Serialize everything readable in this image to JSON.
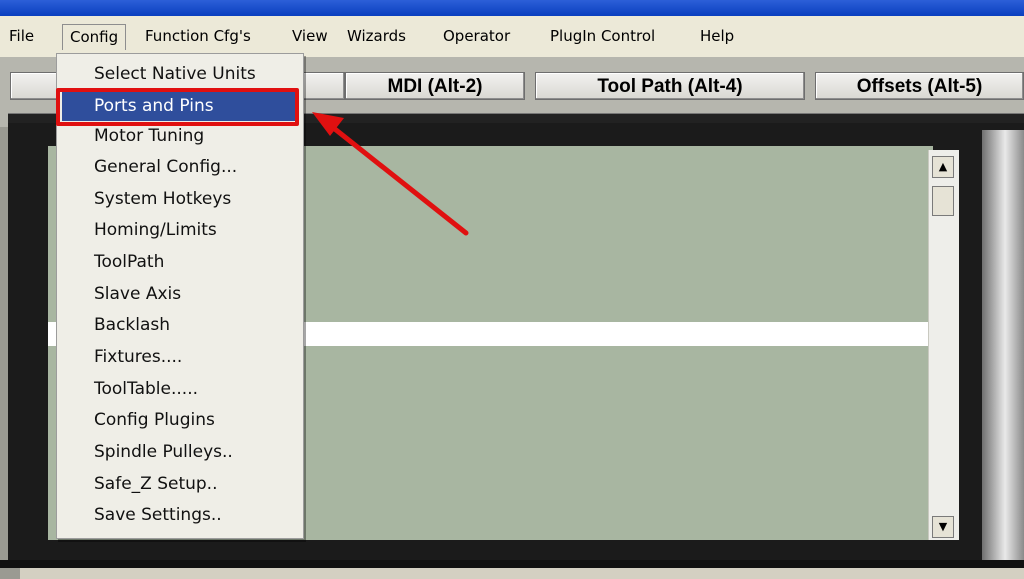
{
  "menubar": {
    "items": [
      "File",
      "Config",
      "Function Cfg's",
      "View",
      "Wizards",
      "Operator",
      "PlugIn Control",
      "Help"
    ]
  },
  "toolbar": {
    "tabs": [
      "MDI (Alt-2)",
      "Tool Path (Alt-4)",
      "Offsets (Alt-5)"
    ]
  },
  "config_menu": {
    "items": [
      "Select Native Units",
      "Ports and Pins",
      "Motor Tuning",
      "General Config...",
      "System Hotkeys",
      "Homing/Limits",
      "ToolPath",
      "Slave Axis",
      "Backlash",
      "Fixtures....",
      "ToolTable.....",
      "Config Plugins",
      "Spindle Pulleys..",
      "Safe_Z Setup..",
      "Save Settings.."
    ],
    "selected": "Ports and Pins"
  },
  "scrollbar": {
    "up_glyph": "▲",
    "down_glyph": "▼"
  },
  "colors": {
    "highlight_box": "#e01010",
    "selection": "#2f4e9c",
    "panel": "#a8b6a1"
  }
}
